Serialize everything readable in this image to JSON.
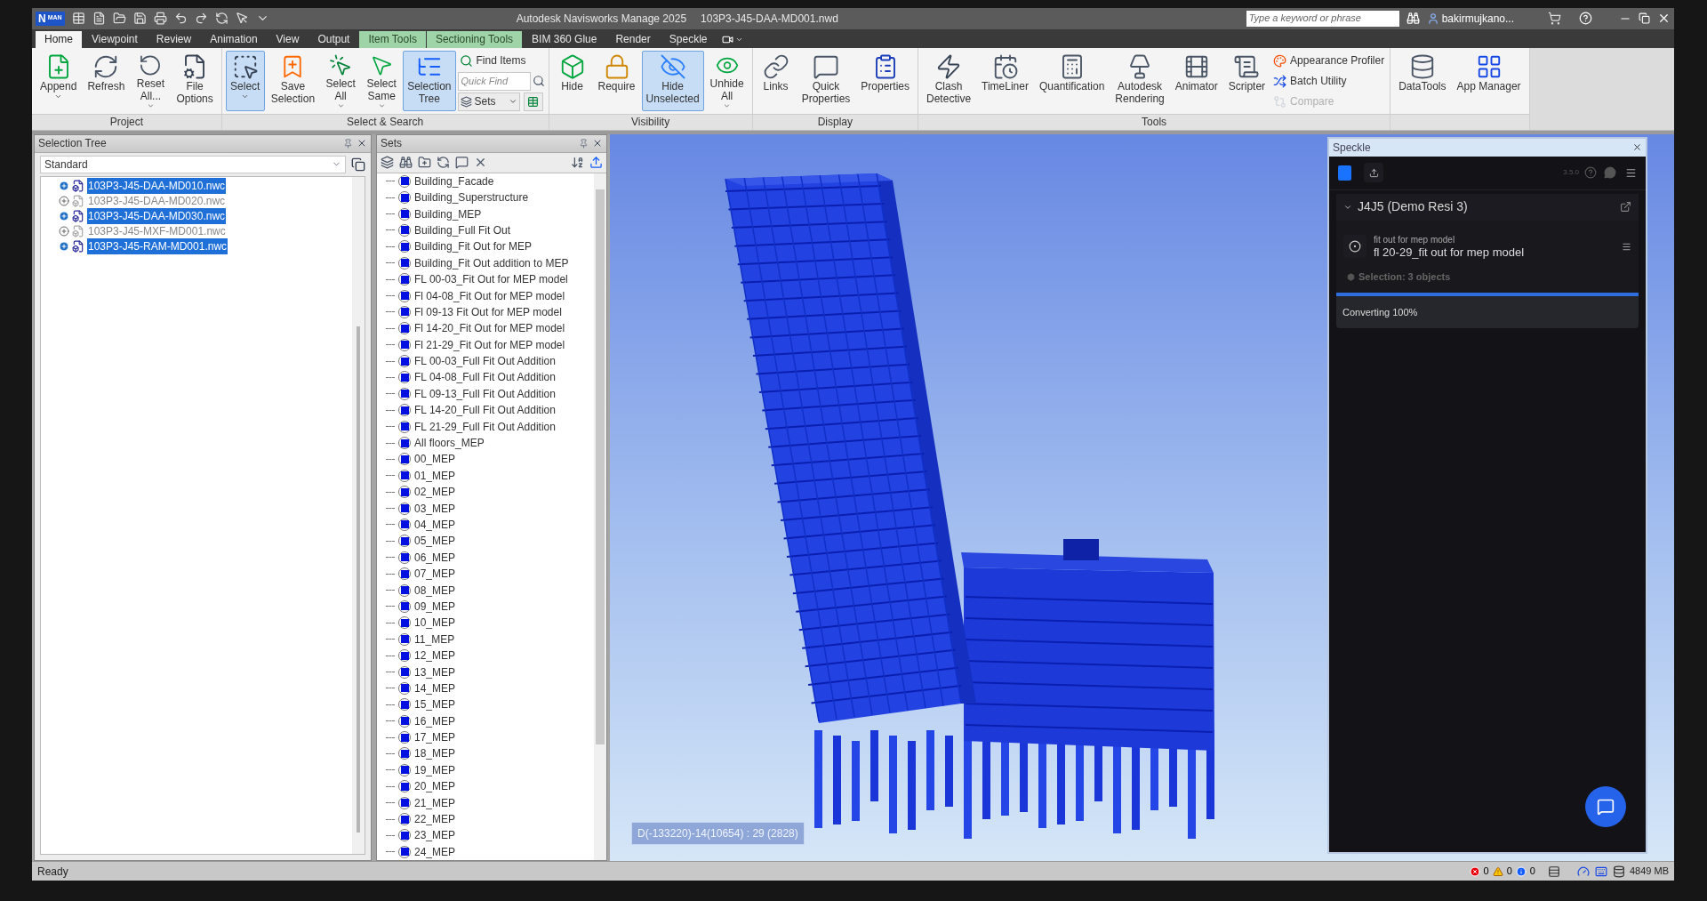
{
  "app_logo": {
    "letter": "N",
    "edition": "MAN"
  },
  "title_bar": {
    "title": "Autodesk Navisworks Manage 2025",
    "document": "103P3-J45-DAA-MD001.nwd",
    "search": {
      "placeholder": "Type a keyword or phrase"
    },
    "user": "bakirmujkano..."
  },
  "tabs": [
    {
      "label": "Home",
      "selected": true,
      "contextual": false
    },
    {
      "label": "Viewpoint",
      "selected": false,
      "contextual": false
    },
    {
      "label": "Review",
      "selected": false,
      "contextual": false
    },
    {
      "label": "Animation",
      "selected": false,
      "contextual": false
    },
    {
      "label": "View",
      "selected": false,
      "contextual": false
    },
    {
      "label": "Output",
      "selected": false,
      "contextual": false
    },
    {
      "label": "Item Tools",
      "selected": false,
      "contextual": true
    },
    {
      "label": "Sectioning Tools",
      "selected": false,
      "contextual": true
    },
    {
      "label": "BIM 360 Glue",
      "selected": false,
      "contextual": false
    },
    {
      "label": "Render",
      "selected": false,
      "contextual": false
    },
    {
      "label": "Speckle",
      "selected": false,
      "contextual": false
    }
  ],
  "ribbon": {
    "groups": [
      {
        "label": "Project",
        "items": [
          {
            "kind": "large",
            "label": "Append",
            "dropdown": true,
            "selected": false
          },
          {
            "kind": "large",
            "label": "Refresh",
            "dropdown": false,
            "selected": false
          },
          {
            "kind": "large",
            "label": "Reset\nAll...",
            "dropdown": true,
            "selected": false
          },
          {
            "kind": "large",
            "label": "File\nOptions",
            "dropdown": false,
            "selected": false
          }
        ]
      },
      {
        "label": "Select & Search",
        "items": [
          {
            "kind": "large",
            "label": "Select",
            "dropdown": true,
            "selected": true
          },
          {
            "kind": "large",
            "label": "Save\nSelection",
            "dropdown": false,
            "selected": false
          },
          {
            "kind": "large",
            "label": "Select\nAll",
            "dropdown": true,
            "selected": false
          },
          {
            "kind": "large",
            "label": "Select\nSame",
            "dropdown": true,
            "selected": false
          },
          {
            "kind": "large",
            "label": "Selection\nTree",
            "dropdown": false,
            "selected": true
          },
          {
            "kind": "stack",
            "items": [
              {
                "kind": "small",
                "label": "Find Items",
                "disabled": false
              },
              {
                "kind": "field",
                "placeholder": "Quick Find"
              },
              {
                "kind": "dropdown",
                "label": "Sets"
              }
            ]
          }
        ]
      },
      {
        "label": "Visibility",
        "items": [
          {
            "kind": "large",
            "label": "Hide",
            "dropdown": false,
            "selected": false
          },
          {
            "kind": "large",
            "label": "Require",
            "dropdown": false,
            "selected": false
          },
          {
            "kind": "large",
            "label": "Hide\nUnselected",
            "dropdown": false,
            "selected": true
          },
          {
            "kind": "large",
            "label": "Unhide\nAll",
            "dropdown": true,
            "selected": false
          }
        ]
      },
      {
        "label": "Display",
        "items": [
          {
            "kind": "large",
            "label": "Links",
            "dropdown": false,
            "selected": false
          },
          {
            "kind": "large",
            "label": "Quick\nProperties",
            "dropdown": false,
            "selected": false
          },
          {
            "kind": "large",
            "label": "Properties",
            "dropdown": false,
            "selected": false
          }
        ]
      },
      {
        "label": "Tools",
        "items": [
          {
            "kind": "large",
            "label": "Clash\nDetective",
            "dropdown": false,
            "selected": false
          },
          {
            "kind": "large",
            "label": "TimeLiner",
            "dropdown": false,
            "selected": false
          },
          {
            "kind": "large",
            "label": "Quantification",
            "dropdown": false,
            "selected": false
          },
          {
            "kind": "large",
            "label": "Autodesk\nRendering",
            "dropdown": false,
            "selected": false
          },
          {
            "kind": "large",
            "label": "Animator",
            "dropdown": false,
            "selected": false
          },
          {
            "kind": "large",
            "label": "Scripter",
            "dropdown": false,
            "selected": false
          },
          {
            "kind": "stack",
            "items": [
              {
                "kind": "small",
                "label": "Appearance Profiler",
                "disabled": false
              },
              {
                "kind": "small",
                "label": "Batch Utility",
                "disabled": false
              },
              {
                "kind": "small",
                "label": "Compare",
                "disabled": true
              }
            ]
          }
        ]
      },
      {
        "items": [
          {
            "kind": "large",
            "label": "DataTools",
            "dropdown": false,
            "selected": false
          },
          {
            "kind": "large",
            "label": "App Manager",
            "dropdown": false,
            "selected": false
          }
        ]
      }
    ]
  },
  "selection_tree": {
    "title": "Selection Tree",
    "mode": "Standard",
    "items": [
      {
        "name": "103P3-J45-DAA-MD010.nwc",
        "selected": true
      },
      {
        "name": "103P3-J45-DAA-MD020.nwc",
        "selected": false
      },
      {
        "name": "103P3-J45-DAA-MD030.nwc",
        "selected": true
      },
      {
        "name": "103P3-J45-MXF-MD001.nwc",
        "selected": false
      },
      {
        "name": "103P3-J45-RAM-MD001.nwc",
        "selected": true
      }
    ]
  },
  "sets": {
    "title": "Sets",
    "items": [
      "Building_Facade",
      "Building_Superstructure",
      "Building_MEP",
      "Building_Full Fit Out",
      "Building_Fit Out for MEP",
      "Building_Fit Out addition to MEP",
      "FL 00-03_Fit Out for MEP model",
      "Fl 04-08_Fit Out for MEP model",
      "Fl 09-13 Fit Out for MEP model",
      "Fl 14-20_Fit Out for MEP model",
      "Fl 21-29_Fit Out for MEP model",
      "FL 00-03_Full Fit Out Addition",
      "FL 04-08_Full Fit Out Addition",
      "FL 09-13_Full Fit Out Addition",
      "FL 14-20_Full Fit Out Addition",
      "FL 21-29_Full Fit Out Addition",
      "All floors_MEP",
      "00_MEP",
      "01_MEP",
      "02_MEP",
      "03_MEP",
      "04_MEP",
      "05_MEP",
      "06_MEP",
      "07_MEP",
      "08_MEP",
      "09_MEP",
      "10_MEP",
      "11_MEP",
      "12_MEP",
      "13_MEP",
      "14_MEP",
      "15_MEP",
      "16_MEP",
      "17_MEP",
      "18_MEP",
      "19_MEP",
      "20_MEP",
      "21_MEP",
      "22_MEP",
      "23_MEP",
      "24_MEP"
    ]
  },
  "viewport": {
    "readout": "D(-133220)-14(10654) : 29 (2828)"
  },
  "speckle": {
    "title": "Speckle",
    "version": "3.5.0",
    "project": {
      "name": "J4J5 (Demo Resi 3)",
      "expanded": true
    },
    "model": {
      "subtitle": "fit out for mep model",
      "name": "fl 20-29_fit out for mep model"
    },
    "selection": "Selection: 3 objects",
    "progress": {
      "label": "Converting 100%",
      "level": 1.0
    }
  },
  "status_bar": {
    "status": "Ready",
    "errors": "0",
    "warnings": "0",
    "infos": "0",
    "memory": "4849 MB"
  }
}
